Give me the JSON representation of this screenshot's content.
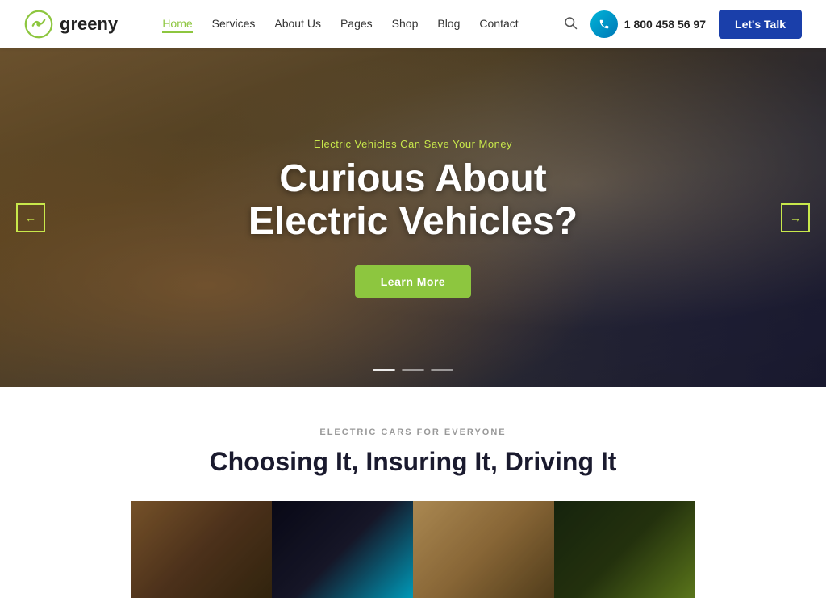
{
  "brand": {
    "logo_text": "greeny",
    "logo_aria": "Greeny logo"
  },
  "navbar": {
    "links": [
      {
        "label": "Home",
        "active": true
      },
      {
        "label": "Services",
        "active": false
      },
      {
        "label": "About Us",
        "active": false
      },
      {
        "label": "Pages",
        "active": false
      },
      {
        "label": "Shop",
        "active": false
      },
      {
        "label": "Blog",
        "active": false
      },
      {
        "label": "Contact",
        "active": false
      }
    ],
    "phone_number": "1 800 458 56 97",
    "phone_avatar_initials": "☎",
    "cta_label": "Let's Talk"
  },
  "hero": {
    "subtitle": "Electric Vehicles Can Save Your Money",
    "title_line1": "Curious About",
    "title_line2": "Electric Vehicles?",
    "cta_label": "Learn More",
    "arrow_left": "←",
    "arrow_right": "→"
  },
  "cars_section": {
    "label": "ELECTRIC CARS FOR EVERYONE",
    "title": "Choosing It, Insuring It, Driving It"
  }
}
